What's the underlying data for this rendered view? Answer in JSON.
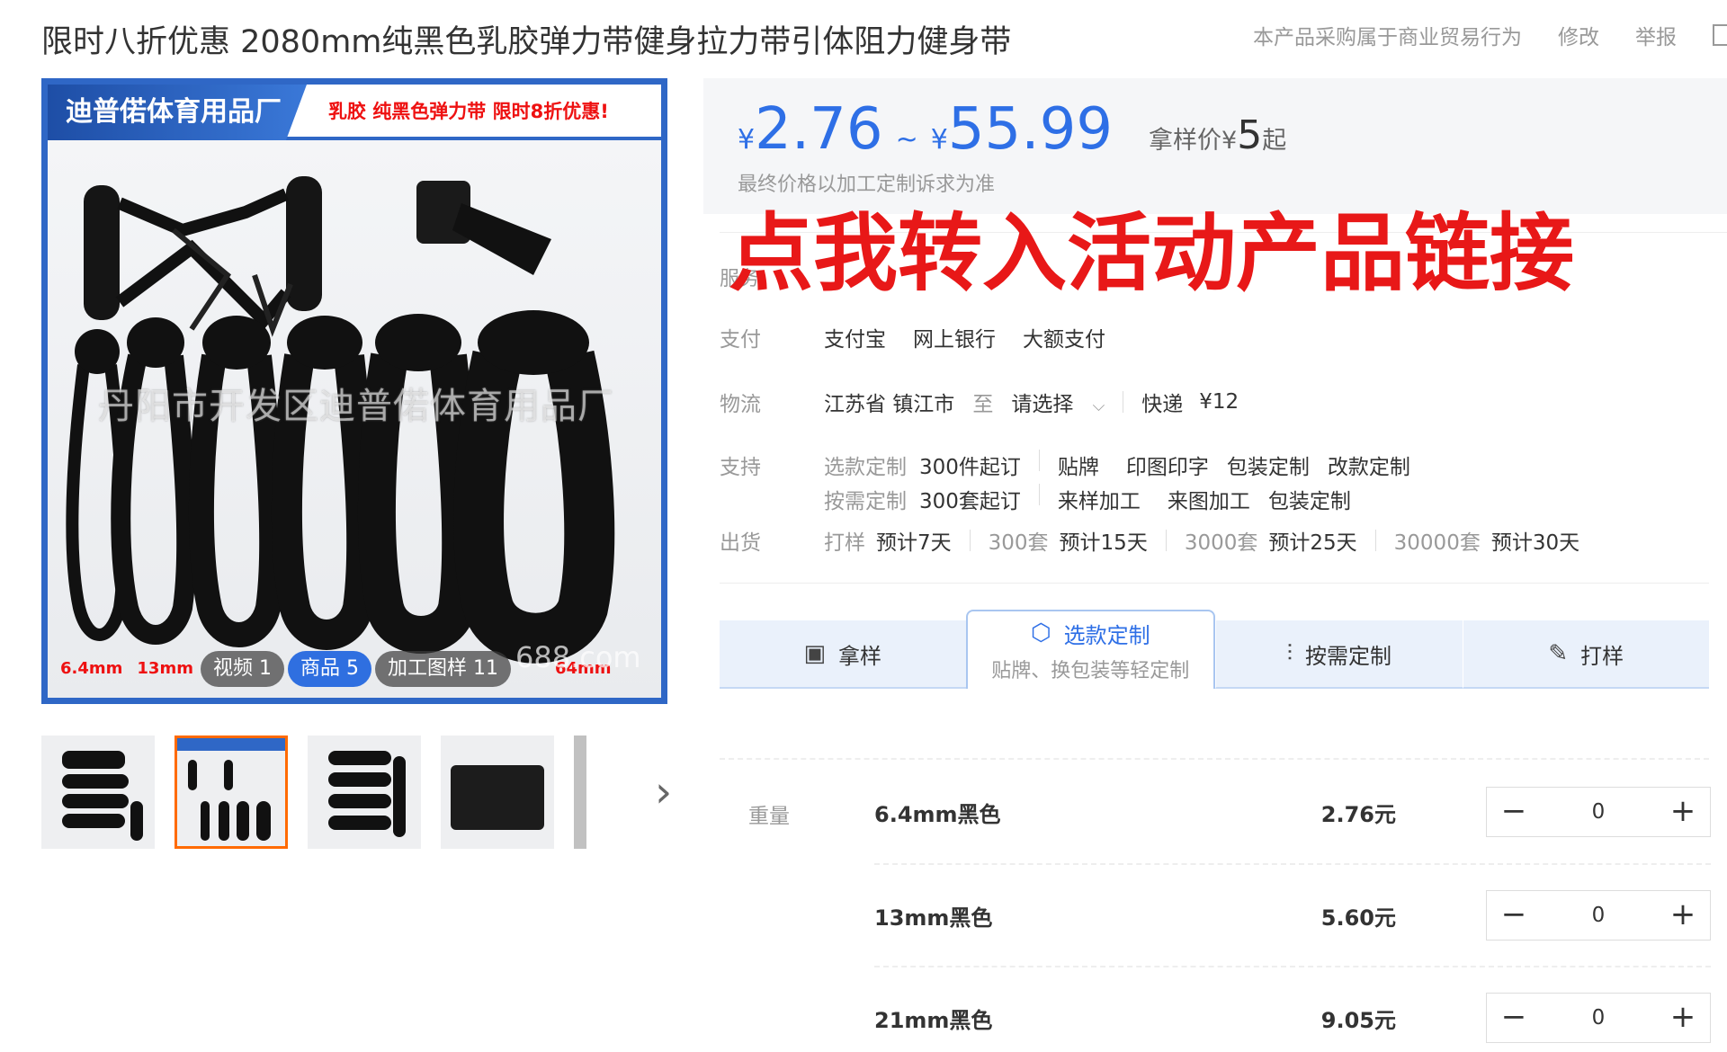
{
  "header": {
    "title": "限时八折优惠 2080mm纯黑色乳胶弹力带健身拉力带引体阻力健身带",
    "trade_note": "本产品采购属于商业贸易行为",
    "edit_link": "修改",
    "report_link": "举报"
  },
  "gallery": {
    "banner_brand": "迪普偌体育用品厂",
    "banner_promo": "乳胶 纯黑色弹力带 限时8折优惠!",
    "watermark": "丹阳市开发区迪普偌体育用品厂",
    "site_watermark": "688.com",
    "size_labels": [
      "6.4mm",
      "13mm",
      "64mm"
    ],
    "media_tabs": [
      {
        "label": "视频",
        "count": "1"
      },
      {
        "label": "商品",
        "count": "5"
      },
      {
        "label": "加工图样",
        "count": "11"
      }
    ],
    "thumb_next": "›"
  },
  "price": {
    "currency": "¥",
    "min": "2.76",
    "tilde": "~",
    "max": "55.99",
    "sample_label": "拿样价",
    "sample_currency": "¥",
    "sample_value": "5",
    "sample_suffix": "起",
    "note": "最终价格以加工定制诉求为准"
  },
  "promo_link": "点我转入活动产品链接",
  "service_label": "服务",
  "payment": {
    "label": "支付",
    "methods": [
      "支付宝",
      "网上银行",
      "大额支付"
    ]
  },
  "logistics": {
    "label": "物流",
    "origin": "江苏省 镇江市",
    "to": "至",
    "destination": "请选择",
    "method": "快递",
    "fee": "¥12"
  },
  "support": {
    "label": "支持",
    "row1_type": "选款定制",
    "row1_moq": "300件起订",
    "row1_items": [
      "贴牌",
      "印图印字",
      "包装定制",
      "改款定制"
    ],
    "row2_type": "按需定制",
    "row2_moq": "300套起订",
    "row2_items": [
      "来样加工",
      "来图加工",
      "包装定制"
    ]
  },
  "shipping": {
    "label": "出货",
    "items": [
      {
        "qty": "打样",
        "time": "预计7天"
      },
      {
        "qty": "300套",
        "time": "预计15天"
      },
      {
        "qty": "3000套",
        "time": "预计25天"
      },
      {
        "qty": "30000套",
        "time": "预计30天"
      }
    ]
  },
  "tabs": [
    {
      "label": "拿样",
      "icon": "sample-icon"
    },
    {
      "label": "选款定制",
      "sub": "贴牌、换包装等轻定制",
      "icon": "cube-icon",
      "active": true
    },
    {
      "label": "按需定制",
      "icon": "sliders-icon"
    },
    {
      "label": "打样",
      "icon": "ruler-icon"
    }
  ],
  "sku": {
    "label": "重量",
    "rows": [
      {
        "name": "6.4mm黑色",
        "price": "2.76元",
        "qty": "0"
      },
      {
        "name": "13mm黑色",
        "price": "5.60元",
        "qty": "0"
      },
      {
        "name": "21mm黑色",
        "price": "9.05元",
        "qty": "0"
      }
    ],
    "minus": "−",
    "plus": "+"
  },
  "colors": {
    "accent": "#2e6fe6",
    "promo": "#e81818",
    "active_thumb": "#ff6a00"
  }
}
